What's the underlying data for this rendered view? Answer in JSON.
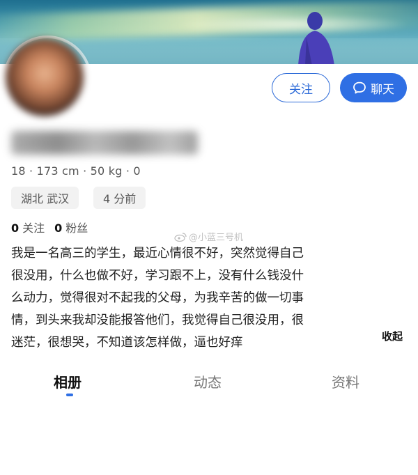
{
  "header": {
    "follow_label": "关注",
    "chat_label": "聊天",
    "accent_color": "#2f6fe4"
  },
  "profile": {
    "stats_line": "18 · 173 cm · 50 kg · 0",
    "location": "湖北 武汉",
    "last_active": "4 分前",
    "following_count": "0",
    "following_label": "关注",
    "followers_count": "0",
    "followers_label": "粉丝",
    "bio_lines": [
      "我是一名高三的学生，最近心情很不好，突然觉得自己",
      "很没用，什么也做不好，学习跟不上，没有什么钱没什",
      "么动力，觉得很对不起我的父母，为我辛苦的做一切事",
      "情，到头来我却没能报答他们，我觉得自己很没用，很",
      "迷茫，很想哭，不知道该怎样做，逼也好痒"
    ],
    "collapse_label": "收起"
  },
  "watermark": {
    "text": "@小蓝三号机",
    "icon": "weibo-icon"
  },
  "tabs": [
    {
      "label": "相册",
      "active": true
    },
    {
      "label": "动态",
      "active": false
    },
    {
      "label": "资料",
      "active": false
    }
  ]
}
